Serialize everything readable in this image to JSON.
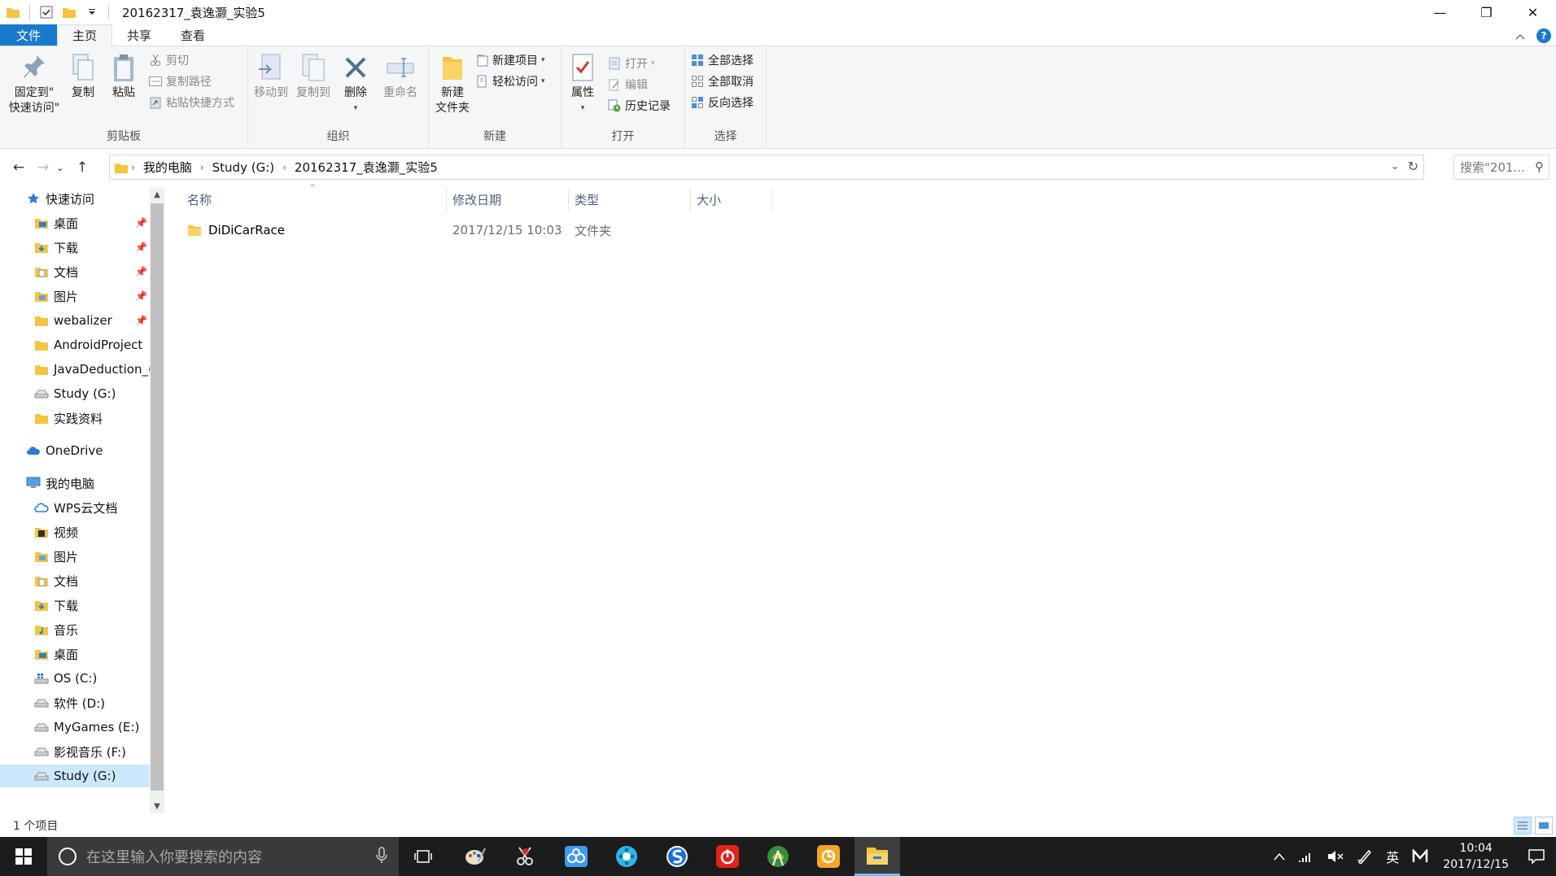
{
  "window": {
    "title": "20162317_袁逸灏_实验5",
    "minimize_glyph": "—",
    "restore_glyph": "❐",
    "close_glyph": "✕"
  },
  "ribbon_tabs": [
    "文件",
    "主页",
    "共享",
    "查看"
  ],
  "ribbon": {
    "clipboard": {
      "label": "剪贴板",
      "pin": "固定到\"\n快速访问\"",
      "pin_line1": "固定到\"",
      "pin_line2": "快速访问\"",
      "copy": "复制",
      "paste": "粘贴",
      "cut": "剪切",
      "copy_path": "复制路径",
      "paste_shortcut": "粘贴快捷方式"
    },
    "organize": {
      "label": "组织",
      "move_to": "移动到",
      "copy_to": "复制到",
      "delete": "删除",
      "rename": "重命名"
    },
    "new": {
      "label": "新建",
      "new_folder_line1": "新建",
      "new_folder_line2": "文件夹",
      "new_item": "新建项目",
      "easy_access": "轻松访问"
    },
    "open": {
      "label": "打开",
      "properties": "属性",
      "open": "打开",
      "edit": "编辑",
      "history": "历史记录"
    },
    "select": {
      "label": "选择",
      "select_all": "全部选择",
      "select_none": "全部取消",
      "invert": "反向选择"
    }
  },
  "address": {
    "crumbs": [
      "我的电脑",
      "Study (G:)",
      "20162317_袁逸灏_实验5"
    ],
    "search_placeholder": "搜索\"201..."
  },
  "nav_pane": {
    "quick_access": "快速访问",
    "quick_items": [
      "桌面",
      "下载",
      "文档",
      "图片",
      "webalizer",
      "AndroidProject",
      "JavaDeduction_(",
      "Study (G:)",
      "实践资料"
    ],
    "onedrive": "OneDrive",
    "this_pc": "我的电脑",
    "pc_items": [
      "WPS云文档",
      "视频",
      "图片",
      "文档",
      "下载",
      "音乐",
      "桌面",
      "OS (C:)",
      "软件 (D:)",
      "MyGames (E:)",
      "影视音乐 (F:)",
      "Study (G:)"
    ]
  },
  "columns": {
    "name": "名称",
    "date": "修改日期",
    "type": "类型",
    "size": "大小"
  },
  "files": [
    {
      "name": "DiDiCarRace",
      "date": "2017/12/15 10:03",
      "type": "文件夹",
      "size": ""
    }
  ],
  "status": {
    "count": "1 个项目"
  },
  "taskbar": {
    "search_placeholder": "在这里输入你要搜索的内容",
    "ime": "英",
    "time": "10:04",
    "date": "2017/12/15"
  },
  "colors": {
    "accent": "#1979ca",
    "folder": "#f4c542",
    "selection": "#cce8ff",
    "taskbar": "#1c1c1c"
  }
}
